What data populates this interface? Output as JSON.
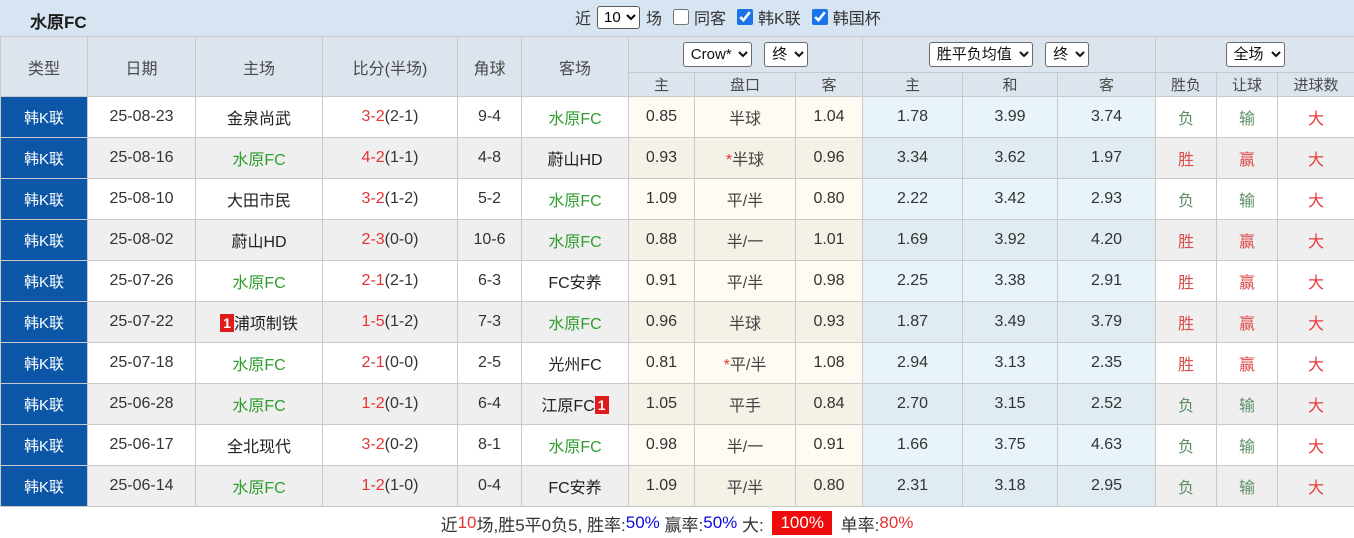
{
  "title": "水原FC",
  "colors": {
    "accent_blue": "#0b56a6",
    "team_green": "#2f9e2f",
    "score_red": "#e53333",
    "win_red": "#dd4c4c",
    "lose_green": "#5d8d68",
    "big_red": "#ea3a3a",
    "topbar_bg": "#d7e5f3",
    "header_bg": "#dce4ee"
  },
  "controls": {
    "recent_label": "近",
    "recent_value": "10",
    "matches_label": "场",
    "same_venue": {
      "label": "同客",
      "checked": false
    },
    "league_k": {
      "label": "韩K联",
      "checked": true
    },
    "korea_cup": {
      "label": "韩国杯",
      "checked": true
    }
  },
  "table": {
    "headers": {
      "type": "类型",
      "date": "日期",
      "home": "主场",
      "score": "比分(半场)",
      "corner": "角球",
      "away": "客场"
    },
    "selects": {
      "company": "Crow*",
      "company_time": "终",
      "europe": "胜平负均值",
      "europe_time": "终",
      "scope": "全场"
    },
    "sub_headers": [
      "主",
      "盘口",
      "客",
      "主",
      "和",
      "客",
      "胜负",
      "让球",
      "进球数"
    ],
    "rows": [
      {
        "league": "韩K联",
        "date": "25-08-23",
        "home": "金泉尚武",
        "home_color": "dark",
        "home_badge": "",
        "score": "3-2",
        "half": "(2-1)",
        "corner": "9-4",
        "away": "水原FC",
        "away_color": "green",
        "away_badge": "",
        "ah_home": "0.85",
        "line_star": "",
        "ah_line": "半球",
        "ah_away": "1.04",
        "eu_home": "1.78",
        "eu_draw": "3.99",
        "eu_away": "3.74",
        "result": "负",
        "result_color": "losegreen",
        "handicap": "输",
        "handicap_color": "losegreen",
        "goals": "大",
        "goals_color": "bigred"
      },
      {
        "league": "韩K联",
        "date": "25-08-16",
        "home": "水原FC",
        "home_color": "green",
        "home_badge": "",
        "score": "4-2",
        "half": "(1-1)",
        "corner": "4-8",
        "away": "蔚山HD",
        "away_color": "dark",
        "away_badge": "",
        "ah_home": "0.93",
        "line_star": "*",
        "ah_line": "半球",
        "ah_away": "0.96",
        "eu_home": "3.34",
        "eu_draw": "3.62",
        "eu_away": "1.97",
        "result": "胜",
        "result_color": "red",
        "handicap": "赢",
        "handicap_color": "red",
        "goals": "大",
        "goals_color": "bigred"
      },
      {
        "league": "韩K联",
        "date": "25-08-10",
        "home": "大田市民",
        "home_color": "dark",
        "home_badge": "",
        "score": "3-2",
        "half": "(1-2)",
        "corner": "5-2",
        "away": "水原FC",
        "away_color": "green",
        "away_badge": "",
        "ah_home": "1.09",
        "line_star": "",
        "ah_line": "平/半",
        "ah_away": "0.80",
        "eu_home": "2.22",
        "eu_draw": "3.42",
        "eu_away": "2.93",
        "result": "负",
        "result_color": "losegreen",
        "handicap": "输",
        "handicap_color": "losegreen",
        "goals": "大",
        "goals_color": "bigred"
      },
      {
        "league": "韩K联",
        "date": "25-08-02",
        "home": "蔚山HD",
        "home_color": "dark",
        "home_badge": "",
        "score": "2-3",
        "half": "(0-0)",
        "corner": "10-6",
        "away": "水原FC",
        "away_color": "green",
        "away_badge": "",
        "ah_home": "0.88",
        "line_star": "",
        "ah_line": "半/一",
        "ah_away": "1.01",
        "eu_home": "1.69",
        "eu_draw": "3.92",
        "eu_away": "4.20",
        "result": "胜",
        "result_color": "red",
        "handicap": "赢",
        "handicap_color": "red",
        "goals": "大",
        "goals_color": "bigred"
      },
      {
        "league": "韩K联",
        "date": "25-07-26",
        "home": "水原FC",
        "home_color": "green",
        "home_badge": "",
        "score": "2-1",
        "half": "(2-1)",
        "corner": "6-3",
        "away": "FC安养",
        "away_color": "dark",
        "away_badge": "",
        "ah_home": "0.91",
        "line_star": "",
        "ah_line": "平/半",
        "ah_away": "0.98",
        "eu_home": "2.25",
        "eu_draw": "3.38",
        "eu_away": "2.91",
        "result": "胜",
        "result_color": "red",
        "handicap": "赢",
        "handicap_color": "red",
        "goals": "大",
        "goals_color": "bigred"
      },
      {
        "league": "韩K联",
        "date": "25-07-22",
        "home": "浦项制铁",
        "home_color": "dark",
        "home_badge": "1",
        "score": "1-5",
        "half": "(1-2)",
        "corner": "7-3",
        "away": "水原FC",
        "away_color": "green",
        "away_badge": "",
        "ah_home": "0.96",
        "line_star": "",
        "ah_line": "半球",
        "ah_away": "0.93",
        "eu_home": "1.87",
        "eu_draw": "3.49",
        "eu_away": "3.79",
        "result": "胜",
        "result_color": "red",
        "handicap": "赢",
        "handicap_color": "red",
        "goals": "大",
        "goals_color": "bigred"
      },
      {
        "league": "韩K联",
        "date": "25-07-18",
        "home": "水原FC",
        "home_color": "green",
        "home_badge": "",
        "score": "2-1",
        "half": "(0-0)",
        "corner": "2-5",
        "away": "光州FC",
        "away_color": "dark",
        "away_badge": "",
        "ah_home": "0.81",
        "line_star": "*",
        "ah_line": "平/半",
        "ah_away": "1.08",
        "eu_home": "2.94",
        "eu_draw": "3.13",
        "eu_away": "2.35",
        "result": "胜",
        "result_color": "red",
        "handicap": "赢",
        "handicap_color": "red",
        "goals": "大",
        "goals_color": "bigred"
      },
      {
        "league": "韩K联",
        "date": "25-06-28",
        "home": "水原FC",
        "home_color": "green",
        "home_badge": "",
        "score": "1-2",
        "half": "(0-1)",
        "corner": "6-4",
        "away": "江原FC",
        "away_color": "dark",
        "away_badge": "1",
        "ah_home": "1.05",
        "line_star": "",
        "ah_line": "平手",
        "ah_away": "0.84",
        "eu_home": "2.70",
        "eu_draw": "3.15",
        "eu_away": "2.52",
        "result": "负",
        "result_color": "losegreen",
        "handicap": "输",
        "handicap_color": "losegreen",
        "goals": "大",
        "goals_color": "bigred"
      },
      {
        "league": "韩K联",
        "date": "25-06-17",
        "home": "全北现代",
        "home_color": "dark",
        "home_badge": "",
        "score": "3-2",
        "half": "(0-2)",
        "corner": "8-1",
        "away": "水原FC",
        "away_color": "green",
        "away_badge": "",
        "ah_home": "0.98",
        "line_star": "",
        "ah_line": "半/一",
        "ah_away": "0.91",
        "eu_home": "1.66",
        "eu_draw": "3.75",
        "eu_away": "4.63",
        "result": "负",
        "result_color": "losegreen",
        "handicap": "输",
        "handicap_color": "losegreen",
        "goals": "大",
        "goals_color": "bigred"
      },
      {
        "league": "韩K联",
        "date": "25-06-14",
        "home": "水原FC",
        "home_color": "green",
        "home_badge": "",
        "score": "1-2",
        "half": "(1-0)",
        "corner": "0-4",
        "away": "FC安养",
        "away_color": "dark",
        "away_badge": "",
        "ah_home": "1.09",
        "line_star": "",
        "ah_line": "平/半",
        "ah_away": "0.80",
        "eu_home": "2.31",
        "eu_draw": "3.18",
        "eu_away": "2.95",
        "result": "负",
        "result_color": "losegreen",
        "handicap": "输",
        "handicap_color": "losegreen",
        "goals": "大",
        "goals_color": "bigred"
      }
    ]
  },
  "summary": {
    "segments": [
      {
        "text": "近",
        "style": "plain"
      },
      {
        "text": "10",
        "style": "red"
      },
      {
        "text": "场,胜5平0负5, ",
        "style": "plain"
      },
      {
        "text": "胜率:",
        "style": "plain"
      },
      {
        "text": "50%",
        "style": "blue"
      },
      {
        "text": " 赢率:",
        "style": "plain"
      },
      {
        "text": "50%",
        "style": "blue"
      },
      {
        "text": " 大: ",
        "style": "plain"
      },
      {
        "text": "100%",
        "style": "redbg"
      },
      {
        "text": " 单率:",
        "style": "plain"
      },
      {
        "text": "80%",
        "style": "red"
      }
    ]
  }
}
